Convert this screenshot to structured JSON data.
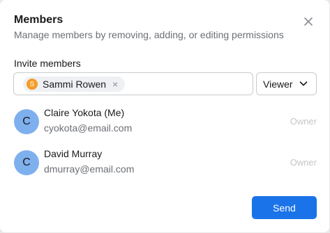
{
  "dialog": {
    "title": "Members",
    "subtitle": "Manage members by removing, adding, or editing permissions"
  },
  "invite": {
    "label": "Invite members",
    "chips": [
      {
        "initial": "S",
        "name": "Sammi Rowen",
        "remove": "×"
      }
    ],
    "role": "Viewer"
  },
  "members": [
    {
      "initial": "C",
      "name": "Claire Yokota (Me)",
      "email": "cyokota@email.com",
      "role": "Owner"
    },
    {
      "initial": "C",
      "name": "David Murray",
      "email": "dmurray@email.com",
      "role": "Owner"
    }
  ],
  "actions": {
    "send_label": "Send"
  },
  "colors": {
    "primary": "#1a73e8",
    "chip_avatar": "#f39c29",
    "member_avatar": "#7fb0ee"
  },
  "icons": {
    "close": "close-icon",
    "role_dropdown": "chevron-down-icon",
    "chip_remove": "close-icon"
  }
}
